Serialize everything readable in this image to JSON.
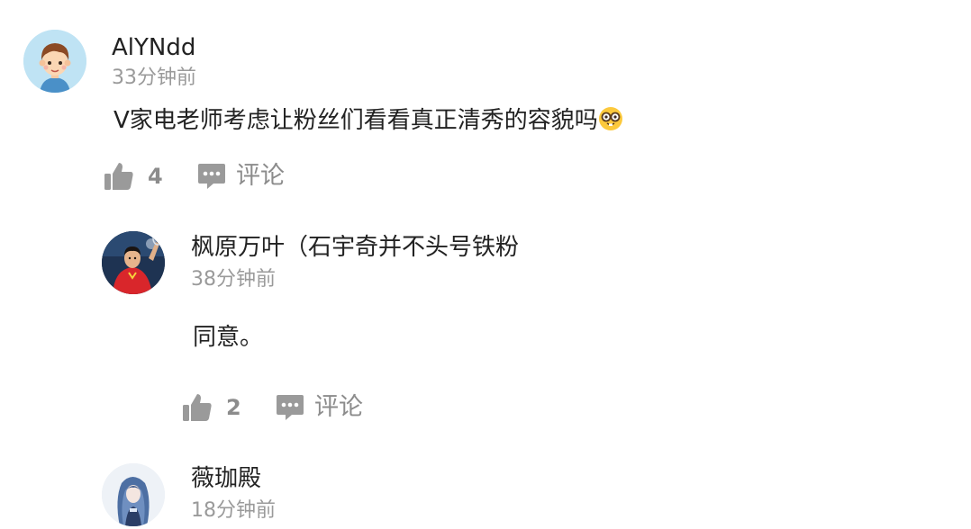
{
  "comments": [
    {
      "username": "AlYNdd",
      "time": "33分钟前",
      "text": "V家电老师考虑让粉丝们看看真正清秀的容貌吗",
      "emoji": "nerd-face-emoji",
      "likes": "4",
      "reply_label": "评论",
      "avatar": "cartoon-boy-avatar"
    },
    {
      "username": "枫原万叶（石宇奇并不头号铁粉",
      "time": "38分钟前",
      "text": "同意。",
      "likes": "2",
      "reply_label": "评论",
      "avatar": "badminton-player-photo-avatar"
    },
    {
      "username": "薇珈殿",
      "time": "18分钟前",
      "avatar": "anime-character-avatar"
    }
  ],
  "colors": {
    "text": "#222222",
    "meta": "#9a9a9a",
    "action": "#8c8c8c",
    "background": "#ffffff"
  }
}
